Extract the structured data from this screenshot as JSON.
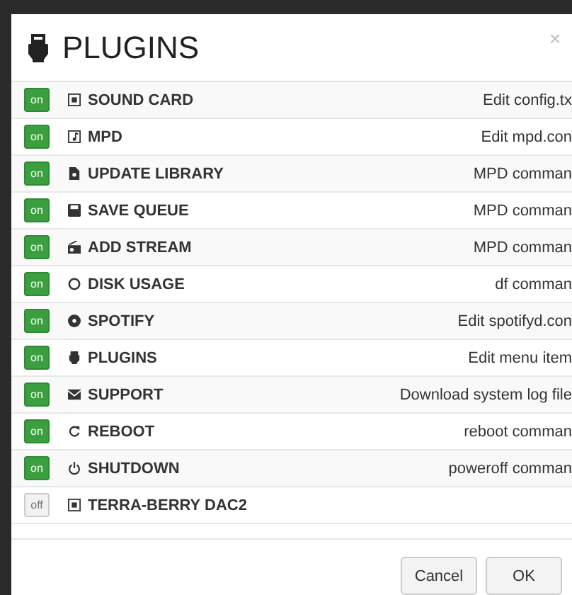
{
  "dialog": {
    "title": "PLUGINS",
    "close": "×"
  },
  "plugins": [
    {
      "toggle": "on",
      "on": true,
      "name": "SOUND CARD",
      "action": "Edit config.tx"
    },
    {
      "toggle": "on",
      "on": true,
      "name": "MPD",
      "action": "Edit mpd.con"
    },
    {
      "toggle": "on",
      "on": true,
      "name": "UPDATE LIBRARY",
      "action": "MPD comman"
    },
    {
      "toggle": "on",
      "on": true,
      "name": "SAVE QUEUE",
      "action": "MPD comman"
    },
    {
      "toggle": "on",
      "on": true,
      "name": "ADD STREAM",
      "action": "MPD comman"
    },
    {
      "toggle": "on",
      "on": true,
      "name": "DISK USAGE",
      "action": "df comman"
    },
    {
      "toggle": "on",
      "on": true,
      "name": "SPOTIFY",
      "action": "Edit spotifyd.con"
    },
    {
      "toggle": "on",
      "on": true,
      "name": "PLUGINS",
      "action": "Edit menu item"
    },
    {
      "toggle": "on",
      "on": true,
      "name": "SUPPORT",
      "action": "Download system log file"
    },
    {
      "toggle": "on",
      "on": true,
      "name": "REBOOT",
      "action": "reboot comman"
    },
    {
      "toggle": "on",
      "on": true,
      "name": "SHUTDOWN",
      "action": "poweroff comman"
    },
    {
      "toggle": "off",
      "on": false,
      "name": "TERRA-BERRY DAC2"
    }
  ],
  "buttons": [
    {
      "label": "Cancel"
    },
    {
      "label": "OK"
    }
  ]
}
